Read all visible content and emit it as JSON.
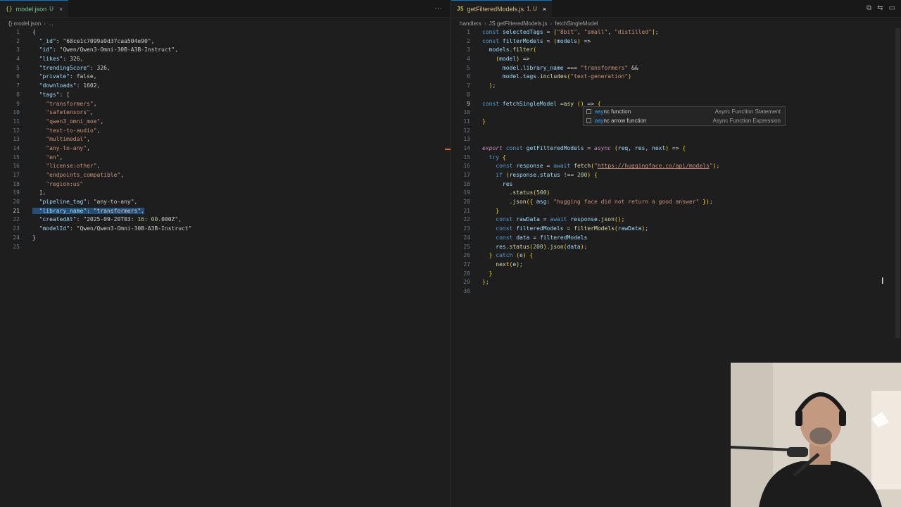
{
  "left_tab": {
    "icon": "{}",
    "name": "model.json",
    "status": "U",
    "close": "×"
  },
  "left_breadcrumb": [
    "{} model.json",
    "..."
  ],
  "left_actions": "···",
  "left_code": [
    "{",
    "  \"_id\": \"68ce1c7099a9d37caa504e90\",",
    "  \"id\": \"Qwen/Qwen3-Omni-30B-A3B-Instruct\",",
    "  \"likes\": 326,",
    "  \"trendingScore\": 326,",
    "  \"private\": false,",
    "  \"downloads\": 1602,",
    "  \"tags\": [",
    "    \"transformers\",",
    "    \"safetensors\",",
    "    \"qwen3_omni_moe\",",
    "    \"text-to-audio\",",
    "    \"multimodal\",",
    "    \"any-to-any\",",
    "    \"en\",",
    "    \"license:other\",",
    "    \"endpoints_compatible\",",
    "    \"region:us\"",
    "  ],",
    "  \"pipeline_tag\": \"any-to-any\",",
    "  \"library_name\": \"transformers\",",
    "  \"createdAt\": \"2025-09-20T03:16:00.000Z\",",
    "  \"modelId\": \"Qwen/Qwen3-Omni-30B-A3B-Instruct\"",
    "}",
    ""
  ],
  "right_tab": {
    "icon": "JS",
    "name": "getFilteredModels.js",
    "status": "1, U",
    "close": "×"
  },
  "right_breadcrumb": [
    "handlers",
    "JS getFilteredModels.js",
    "fetchSingleModel"
  ],
  "right_actions": [
    "⧉",
    "⇆",
    "▭"
  ],
  "right_code": [
    "const selectedTags = [\"8bit\", \"small\", \"distilled\"];",
    "const filterModels = (models) =>",
    "  models.filter(",
    "    (model) =>",
    "      model.library_name === \"transformers\" &&",
    "      model.tags.includes(\"text-generation\")",
    "  );",
    "",
    "const fetchSingleModel =asy () => {",
    "",
    "}",
    "",
    "",
    "export const getFilteredModels = async (req, res, next) => {",
    "  try {",
    "    const response = await fetch(\"https://huggingface.co/api/models\");",
    "    if (response.status !== 200) {",
    "      res",
    "        .status(500)",
    "        .json({ msg: \"hugging face did not return a good answer\" });",
    "    }",
    "    const rawData = await response.json();",
    "    const filteredModels = filterModels(rawData);",
    "    const data = filteredModels",
    "    res.status(200).json(data);",
    "  } catch (e) {",
    "    next(e);",
    "  }",
    "};",
    ""
  ],
  "autocomplete": [
    {
      "match": "asy",
      "rest": "nc function",
      "detail": "Async Function Statement"
    },
    {
      "match": "asy",
      "rest": "nc arrow function",
      "detail": "Async Function Expression"
    }
  ],
  "colors": {
    "accent": "#0078d4",
    "untracked": "#73c991",
    "background": "#1e1e1e"
  }
}
